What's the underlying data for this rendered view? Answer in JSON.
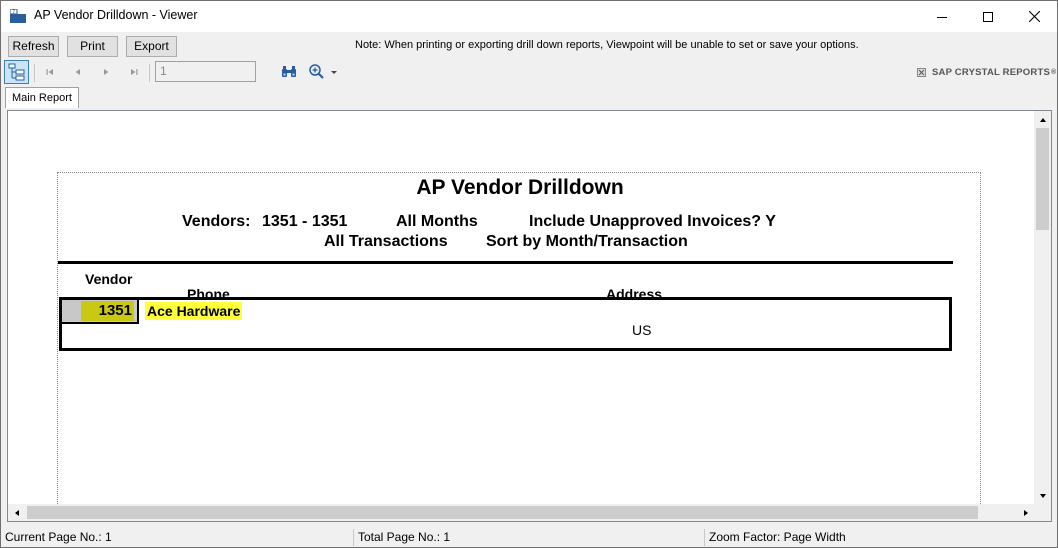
{
  "window": {
    "title": "AP Vendor Drilldown - Viewer"
  },
  "buttons": {
    "refresh": "Refresh",
    "print": "Print",
    "export": "Export"
  },
  "note": "Note: When printing or exporting drill down reports, Viewpoint will be unable to set or save your options.",
  "toolbar": {
    "page_value": "1",
    "brand": "SAP CRYSTAL REPORTS",
    "brand_mark": "®"
  },
  "tabs": [
    {
      "label": "Main Report"
    }
  ],
  "report": {
    "title": "AP Vendor Drilldown",
    "vendors_label": "Vendors:",
    "vendors_range": "1351 - 1351",
    "months": "All Months",
    "unapproved": "Include Unapproved Invoices? Y",
    "transactions": "All Transactions",
    "sort": "Sort by Month/Transaction",
    "columns": {
      "vendor": "Vendor",
      "phone": "Phone",
      "address": "Address"
    },
    "rows": [
      {
        "vendor_no": "1351",
        "name": "Ace Hardware",
        "country": "US"
      }
    ]
  },
  "status": {
    "current_page": "Current Page No.: 1",
    "total_page": "Total Page No.: 1",
    "zoom": "Zoom Factor: Page Width"
  },
  "colors": {
    "vendor_no_highlight": "#c9c914",
    "vendor_name_highlight": "#ffff3c",
    "tree_toggle_active": "#cce4f7"
  }
}
